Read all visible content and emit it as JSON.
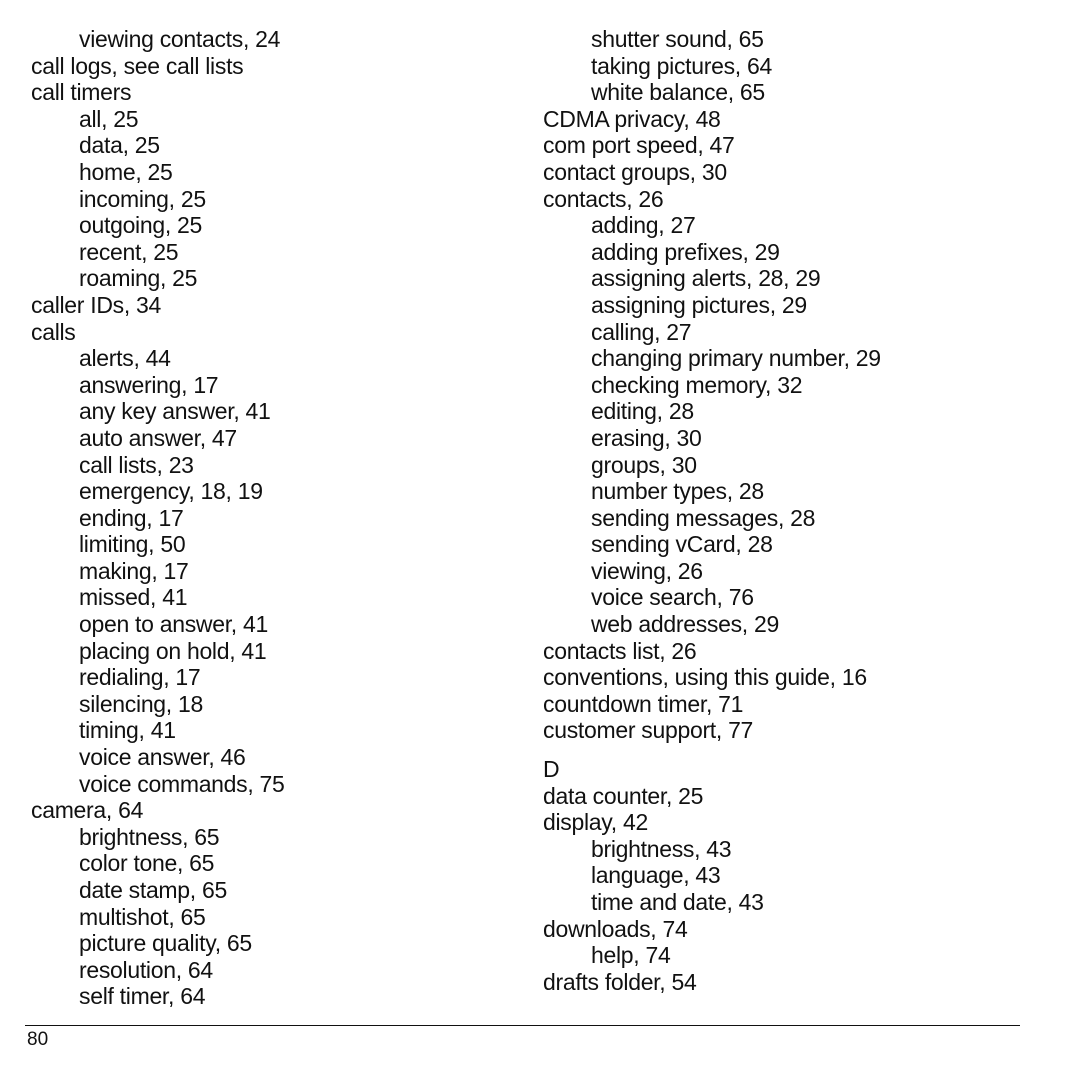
{
  "left_column": [
    {
      "level": 1,
      "text": "viewing contacts, 24"
    },
    {
      "level": 0,
      "text": "call logs, see call lists"
    },
    {
      "level": 0,
      "text": "call timers"
    },
    {
      "level": 1,
      "text": "all, 25"
    },
    {
      "level": 1,
      "text": "data, 25"
    },
    {
      "level": 1,
      "text": "home, 25"
    },
    {
      "level": 1,
      "text": "incoming, 25"
    },
    {
      "level": 1,
      "text": "outgoing, 25"
    },
    {
      "level": 1,
      "text": "recent, 25"
    },
    {
      "level": 1,
      "text": "roaming, 25"
    },
    {
      "level": 0,
      "text": "caller IDs, 34"
    },
    {
      "level": 0,
      "text": "calls"
    },
    {
      "level": 1,
      "text": "alerts, 44"
    },
    {
      "level": 1,
      "text": "answering, 17"
    },
    {
      "level": 1,
      "text": "any key answer, 41"
    },
    {
      "level": 1,
      "text": "auto answer, 47"
    },
    {
      "level": 1,
      "text": "call lists, 23"
    },
    {
      "level": 1,
      "text": "emergency, 18, 19"
    },
    {
      "level": 1,
      "text": "ending, 17"
    },
    {
      "level": 1,
      "text": "limiting, 50"
    },
    {
      "level": 1,
      "text": "making, 17"
    },
    {
      "level": 1,
      "text": "missed, 41"
    },
    {
      "level": 1,
      "text": "open to answer, 41"
    },
    {
      "level": 1,
      "text": "placing on hold, 41"
    },
    {
      "level": 1,
      "text": "redialing, 17"
    },
    {
      "level": 1,
      "text": "silencing, 18"
    },
    {
      "level": 1,
      "text": "timing, 41"
    },
    {
      "level": 1,
      "text": "voice answer, 46"
    },
    {
      "level": 1,
      "text": "voice commands, 75"
    },
    {
      "level": 0,
      "text": "camera, 64"
    },
    {
      "level": 1,
      "text": "brightness, 65"
    },
    {
      "level": 1,
      "text": "color tone, 65"
    },
    {
      "level": 1,
      "text": "date stamp, 65"
    },
    {
      "level": 1,
      "text": "multishot, 65"
    },
    {
      "level": 1,
      "text": "picture quality, 65"
    },
    {
      "level": 1,
      "text": "resolution, 64"
    },
    {
      "level": 1,
      "text": "self timer, 64"
    }
  ],
  "right_column": [
    {
      "level": 1,
      "text": "shutter sound, 65"
    },
    {
      "level": 1,
      "text": "taking pictures, 64"
    },
    {
      "level": 1,
      "text": "white balance, 65"
    },
    {
      "level": 0,
      "text": "CDMA privacy, 48"
    },
    {
      "level": 0,
      "text": "com port speed, 47"
    },
    {
      "level": 0,
      "text": "contact groups, 30"
    },
    {
      "level": 0,
      "text": "contacts, 26"
    },
    {
      "level": 1,
      "text": "adding, 27"
    },
    {
      "level": 1,
      "text": "adding prefixes, 29"
    },
    {
      "level": 1,
      "text": "assigning alerts, 28, 29"
    },
    {
      "level": 1,
      "text": "assigning pictures, 29"
    },
    {
      "level": 1,
      "text": "calling, 27"
    },
    {
      "level": 1,
      "text": "changing primary number, 29"
    },
    {
      "level": 1,
      "text": "checking memory, 32"
    },
    {
      "level": 1,
      "text": "editing, 28"
    },
    {
      "level": 1,
      "text": "erasing, 30"
    },
    {
      "level": 1,
      "text": "groups, 30"
    },
    {
      "level": 1,
      "text": "number types, 28"
    },
    {
      "level": 1,
      "text": "sending messages, 28"
    },
    {
      "level": 1,
      "text": "sending vCard, 28"
    },
    {
      "level": 1,
      "text": "viewing, 26"
    },
    {
      "level": 1,
      "text": "voice search, 76"
    },
    {
      "level": 1,
      "text": "web addresses, 29"
    },
    {
      "level": 0,
      "text": "contacts list, 26"
    },
    {
      "level": 0,
      "text": "conventions, using this guide, 16"
    },
    {
      "level": 0,
      "text": "countdown timer, 71"
    },
    {
      "level": 0,
      "text": "customer support, 77"
    },
    {
      "level": "letter",
      "text": "D"
    },
    {
      "level": 0,
      "text": "data counter, 25"
    },
    {
      "level": 0,
      "text": "display, 42"
    },
    {
      "level": 1,
      "text": "brightness, 43"
    },
    {
      "level": 1,
      "text": "language, 43"
    },
    {
      "level": 1,
      "text": "time and date, 43"
    },
    {
      "level": 0,
      "text": "downloads, 74"
    },
    {
      "level": 1,
      "text": "help, 74"
    },
    {
      "level": 0,
      "text": "drafts folder, 54"
    }
  ],
  "footer": {
    "page_number": "80"
  }
}
